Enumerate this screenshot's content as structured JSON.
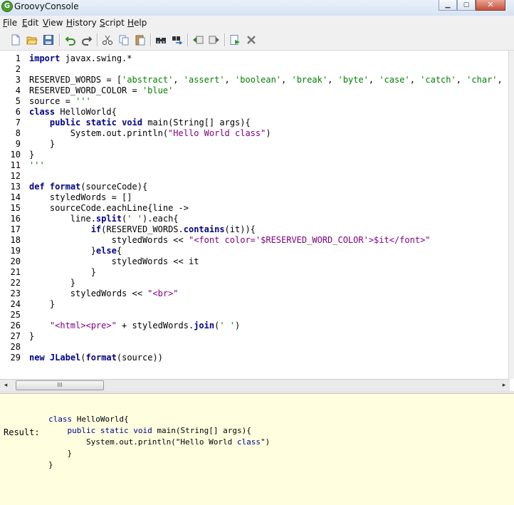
{
  "window": {
    "title": "GroovyConsole",
    "app_icon_glyph": "G"
  },
  "menu": [
    "File",
    "Edit",
    "View",
    "History",
    "Script",
    "Help"
  ],
  "toolbar": {
    "icons": [
      "new-file-icon",
      "open-folder-icon",
      "save-icon",
      "undo-icon",
      "redo-icon",
      "cut-icon",
      "copy-icon",
      "paste-icon",
      "find-icon",
      "replace-icon",
      "history-prev-icon",
      "history-next-icon",
      "run-script-icon",
      "interrupt-icon"
    ]
  },
  "editor": {
    "lines": [
      "import javax.swing.*",
      "",
      "RESERVED_WORDS = ['abstract', 'assert', 'boolean', 'break', 'byte', 'case', 'catch', 'char', 'cl",
      "RESERVED_WORD_COLOR = 'blue'",
      "source = '''",
      "class HelloWorld{",
      "    public static void main(String[] args){",
      "        System.out.println(\"Hello World class\")",
      "    }",
      "}",
      "'''",
      "",
      "def format(sourceCode){",
      "    styledWords = []",
      "    sourceCode.eachLine{line ->",
      "        line.split(' ').each{",
      "            if(RESERVED_WORDS.contains(it)){",
      "                styledWords << \"<font color='$RESERVED_WORD_COLOR'>$it</font>\"",
      "            }else{",
      "                styledWords << it",
      "            }",
      "        }",
      "        styledWords << \"<br>\"",
      "    }",
      "",
      "    \"<html><pre>\" + styledWords.join(' ')",
      "}",
      "",
      "new JLabel(format(source))"
    ]
  },
  "hscroll": {
    "thumb_grip": "III",
    "left_arrow": "◂",
    "right_arrow": "▸"
  },
  "output": {
    "result_label": "Result:",
    "lines": [
      "class HelloWorld{",
      "    public static void main(String[] args){",
      "        System.out.println(\"Hello World class\")",
      "    }",
      "}"
    ]
  },
  "colors": {
    "keyword": "#00008b",
    "string": "#008000",
    "gstring": "#800080",
    "output_background": "#ffffe0"
  }
}
